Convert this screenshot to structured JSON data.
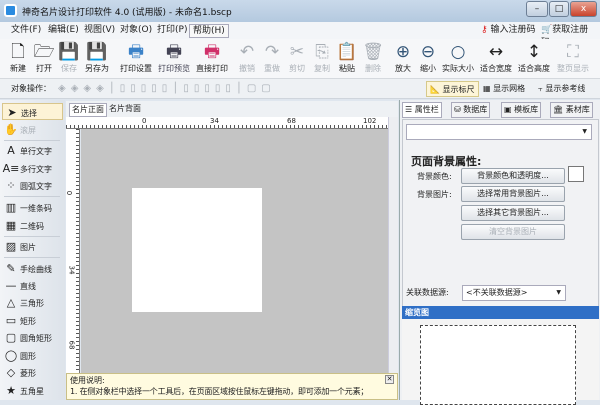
{
  "window": {
    "title": "神奇名片设计打印软件 4.0 (试用版) - 未命名1.bscp",
    "minimize": "–",
    "maximize": "□",
    "close": "x"
  },
  "menu": [
    {
      "label": "文件(F)"
    },
    {
      "label": "编辑(E)"
    },
    {
      "label": "视图(V)"
    },
    {
      "label": "对象(O)"
    },
    {
      "label": "打印(P)"
    },
    {
      "label": "帮助(H)"
    }
  ],
  "register": {
    "enter_code": "输入注册码",
    "get_code": "获取注册码"
  },
  "toolbar": [
    {
      "label": "新建",
      "icon": "🗋"
    },
    {
      "label": "打开",
      "icon": "🗁"
    },
    {
      "label": "保存",
      "icon": "💾",
      "disabled": true
    },
    {
      "label": "另存为",
      "icon": "💾"
    },
    {
      "label": "打印设置",
      "icon": "🖶"
    },
    {
      "label": "打印预览",
      "icon": "🖶"
    },
    {
      "label": "直接打印",
      "icon": "🖶"
    },
    {
      "label": "撤销",
      "icon": "↶",
      "disabled": true
    },
    {
      "label": "重做",
      "icon": "↷",
      "disabled": true
    },
    {
      "label": "剪切",
      "icon": "✂",
      "disabled": true
    },
    {
      "label": "复制",
      "icon": "⎘",
      "disabled": true
    },
    {
      "label": "粘贴",
      "icon": "📋"
    },
    {
      "label": "删除",
      "icon": "🗑",
      "disabled": true
    },
    {
      "label": "放大",
      "icon": "⊕"
    },
    {
      "label": "缩小",
      "icon": "⊖"
    },
    {
      "label": "实际大小",
      "icon": "○"
    },
    {
      "label": "适合宽度",
      "icon": "↔"
    },
    {
      "label": "适合高度",
      "icon": "↕"
    },
    {
      "label": "整页显示",
      "icon": "⛶",
      "disabled": true
    }
  ],
  "objbar": {
    "label": "对象操作：",
    "show_ruler": "显示标尺",
    "show_grid": "显示网格",
    "show_guides": "显示参考线"
  },
  "tools": [
    {
      "label": "选择",
      "icon": "➤"
    },
    {
      "label": "滚屏",
      "icon": "✋"
    },
    {
      "label": "单行文字",
      "icon": "A"
    },
    {
      "label": "多行文字",
      "icon": "A≡"
    },
    {
      "label": "圆弧文字",
      "icon": "⁘"
    },
    {
      "label": "一维条码",
      "icon": "▥"
    },
    {
      "label": "二维码",
      "icon": "▦"
    },
    {
      "label": "图片",
      "icon": "▨"
    },
    {
      "label": "手绘曲线",
      "icon": "✎"
    },
    {
      "label": "直线",
      "icon": "—"
    },
    {
      "label": "三角形",
      "icon": "△"
    },
    {
      "label": "矩形",
      "icon": "▭"
    },
    {
      "label": "圆角矩形",
      "icon": "▢"
    },
    {
      "label": "圆形",
      "icon": "◯"
    },
    {
      "label": "菱形",
      "icon": "◇"
    },
    {
      "label": "五角星",
      "icon": "★"
    }
  ],
  "doc_tabs": {
    "front": "名片正面",
    "back": "名片背面"
  },
  "ruler": {
    "h": [
      "0",
      "34",
      "68",
      "102"
    ],
    "v": [
      "0",
      "34",
      "68"
    ]
  },
  "help": {
    "title": "使用说明:",
    "line1": "1. 在侧对象栏中选择一个工具后，在页面区域按住鼠标左键拖动，即可添加一个元素；"
  },
  "right": {
    "tabs": [
      "属性栏",
      "数据库",
      "模板库",
      "素材库"
    ],
    "section_title": "页面背景属性:",
    "bg_color_label": "背景颜色:",
    "bg_image_label": "背景图片:",
    "btn_color": "背景颜色和透明度...",
    "btn_common": "选择常用背景图片...",
    "btn_other": "选择其它背景图片...",
    "btn_clear": "清空背景图片",
    "datasource_label": "关联数据源:",
    "datasource_value": "<不关联数据源>",
    "thumbnail_title": "缩览图"
  }
}
